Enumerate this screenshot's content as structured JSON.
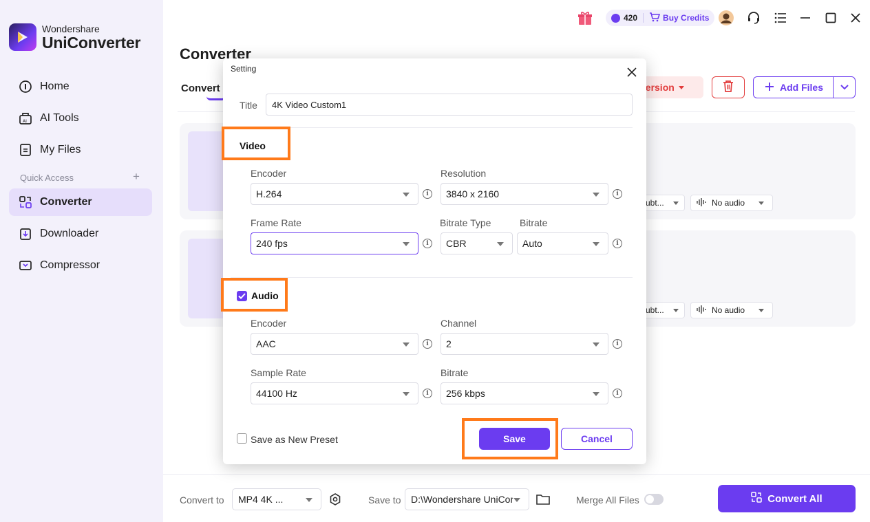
{
  "app": {
    "brand_top": "Wondershare",
    "brand_main": "UniConverter"
  },
  "sidebar": {
    "items": [
      {
        "label": "Home",
        "icon": "home-icon"
      },
      {
        "label": "AI Tools",
        "icon": "ai-tools-icon"
      },
      {
        "label": "My Files",
        "icon": "file-icon"
      },
      {
        "label": "Converter",
        "icon": "converter-icon",
        "active": true
      },
      {
        "label": "Downloader",
        "icon": "downloader-icon"
      },
      {
        "label": "Compressor",
        "icon": "compressor-icon"
      }
    ],
    "quick_access": "Quick Access",
    "quick_access_add": "+"
  },
  "topbar": {
    "credits_count": "420",
    "buy_credits": "Buy Credits"
  },
  "main": {
    "title": "Converter",
    "tab_convert": "Convert",
    "high_speed_label": "version",
    "add_files": "Add Files",
    "files": [
      {
        "subtitle_chip": "ubt...",
        "audio_chip": "No audio"
      },
      {
        "subtitle_chip": "ubt...",
        "audio_chip": "No audio"
      }
    ]
  },
  "bottom": {
    "convert_to_label": "Convert to",
    "convert_to_value": "MP4 4K ...",
    "save_to_label": "Save to",
    "save_to_value": "D:\\Wondershare UniCor",
    "merge_label": "Merge All Files",
    "merge_on": false,
    "convert_all": "Convert All"
  },
  "dialog": {
    "title": "Setting",
    "title_label": "Title",
    "title_value": "4K Video Custom1",
    "video": {
      "heading": "Video",
      "encoder_label": "Encoder",
      "encoder_value": "H.264",
      "resolution_label": "Resolution",
      "resolution_value": "3840 x 2160",
      "frame_rate_label": "Frame Rate",
      "frame_rate_value": "240 fps",
      "bitrate_type_label": "Bitrate Type",
      "bitrate_type_value": "CBR",
      "bitrate_label": "Bitrate",
      "bitrate_value": "Auto"
    },
    "audio": {
      "heading": "Audio",
      "enabled": true,
      "encoder_label": "Encoder",
      "encoder_value": "AAC",
      "channel_label": "Channel",
      "channel_value": "2",
      "sample_rate_label": "Sample Rate",
      "sample_rate_value": "44100 Hz",
      "bitrate_label": "Bitrate",
      "bitrate_value": "256 kbps"
    },
    "save_as_preset": "Save as New Preset",
    "save_as_preset_checked": false,
    "save": "Save",
    "cancel": "Cancel"
  },
  "colors": {
    "accent": "#6b3cf0",
    "highlight": "#ff7a1a",
    "danger": "#e23b3b"
  }
}
